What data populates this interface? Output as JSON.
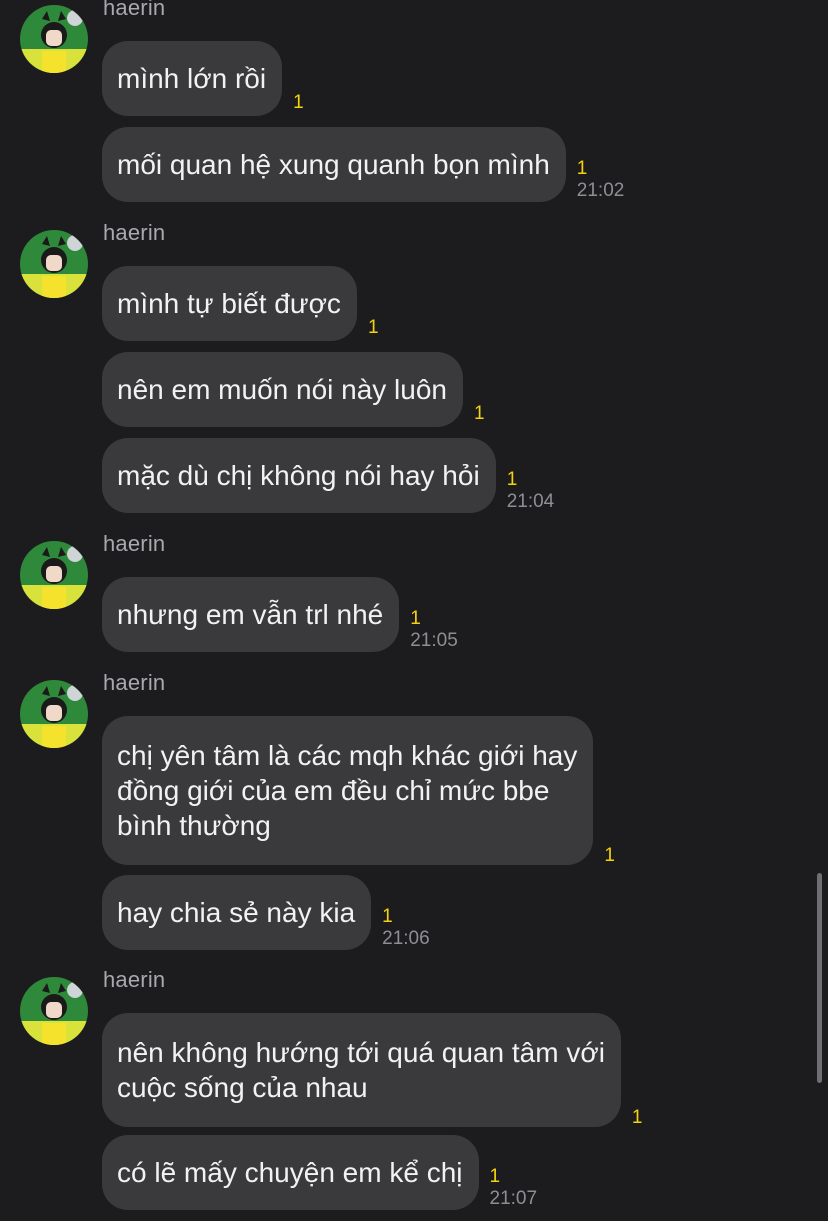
{
  "groups": [
    {
      "sender": "haerin",
      "messages": [
        {
          "text": "mình lớn rồi",
          "unread": "1",
          "time": ""
        },
        {
          "text": "mối quan hệ xung quanh bọn mình",
          "unread": "1",
          "time": "21:02"
        }
      ]
    },
    {
      "sender": "haerin",
      "messages": [
        {
          "text": "mình tự biết được",
          "unread": "1",
          "time": ""
        },
        {
          "text": "nên em muốn nói này luôn",
          "unread": "1",
          "time": ""
        },
        {
          "text": "mặc dù chị không nói hay hỏi",
          "unread": "1",
          "time": "21:04"
        }
      ]
    },
    {
      "sender": "haerin",
      "messages": [
        {
          "text": "nhưng em vẫn trl nhé",
          "unread": "1",
          "time": "21:05"
        }
      ]
    },
    {
      "sender": "haerin",
      "messages": [
        {
          "text": "chị yên tâm là các mqh khác giới hay\nđồng giới của em đều chỉ mức bbe\nbình thường",
          "unread": "1",
          "time": ""
        },
        {
          "text": "hay chia sẻ này kia",
          "unread": "1",
          "time": "21:06"
        }
      ]
    },
    {
      "sender": "haerin",
      "messages": [
        {
          "text": "nên không hướng tới quá quan tâm với\ncuộc sống của nhau",
          "unread": "1",
          "time": ""
        },
        {
          "text": "có lẽ mấy chuyện em kể chị",
          "unread": "1",
          "time": "21:07"
        }
      ]
    }
  ],
  "avatar_icon": "profile-avatar",
  "colors": {
    "background": "#1c1c1e",
    "bubble": "#3a3a3c",
    "unread": "#f5d20a",
    "time": "#8e8e93",
    "sender": "#a8a8ad"
  }
}
